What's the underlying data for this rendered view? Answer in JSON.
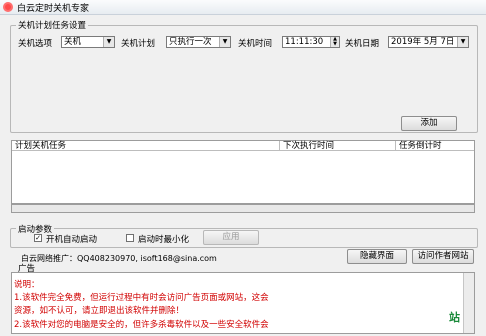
{
  "window": {
    "title": "白云定时关机专家"
  },
  "settings_group": {
    "legend": "关机计划任务设置",
    "option_label": "关机选项",
    "option_value": "关机",
    "plan_label": "关机计划",
    "plan_value": "只执行一次",
    "time_label": "关机时间",
    "time_value": "11:11:30",
    "date_label": "关机日期",
    "date_value": "2019年 5月 7日",
    "add_button": "添加"
  },
  "task_table": {
    "columns": [
      "计划关机任务",
      "下次执行时间",
      "任务倒计时"
    ]
  },
  "startup_group": {
    "legend": "启动参数",
    "auto_start_label": "开机自动启动",
    "auto_start_checked": true,
    "minimize_label": "启动时最小化",
    "minimize_checked": false,
    "apply_button": "应用"
  },
  "promo": {
    "text": "白云网络推广：QQ408230970, isoft168@sina.com",
    "hide_button": "隐藏界面",
    "visit_button": "访问作者网站"
  },
  "ad_group": {
    "legend": "广告",
    "lines": [
      "说明：",
      "1.该软件完全免费，但运行过程中有时会访问广告页面或网站，这会",
      "资源，如不认可，请立即退出该软件并删除！",
      "2.该软件对您的电脑是安全的，但许多杀毒软件以及一些安全软件会"
    ],
    "watermark": "站"
  }
}
